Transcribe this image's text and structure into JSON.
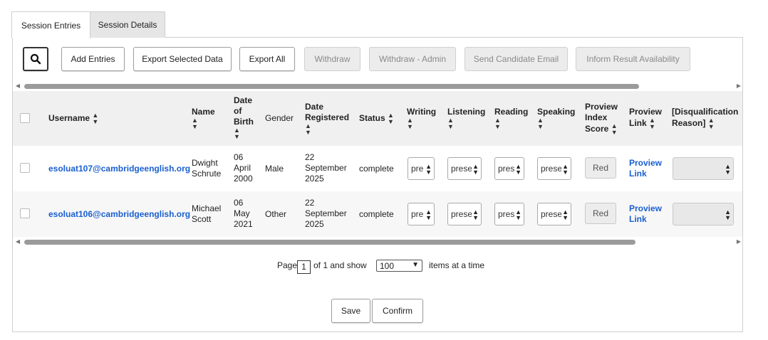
{
  "tabs": {
    "session_entries": "Session Entries",
    "session_details": "Session Details"
  },
  "toolbar": {
    "add_entries": "Add Entries",
    "export_selected": "Export Selected Data",
    "export_all": "Export All",
    "withdraw": "Withdraw",
    "withdraw_admin": "Withdraw - Admin",
    "send_email": "Send Candidate Email",
    "inform_result": "Inform Result Availability"
  },
  "columns": {
    "username": "Username",
    "name": "Name",
    "dob": [
      "Date",
      "of",
      "Birth"
    ],
    "gender": "Gender",
    "date_registered": [
      "Date",
      "Registered"
    ],
    "status": "Status",
    "writing": "Writing",
    "listening": "Listening",
    "reading": "Reading",
    "speaking": "Speaking",
    "proview_score": [
      "Proview",
      "Index",
      "Score"
    ],
    "proview_link": [
      "Proview",
      "Link"
    ],
    "disqualification": [
      "[Disqualification",
      "Reason]"
    ]
  },
  "rows": [
    {
      "username": "esoluat107@cambridgeenglish.org",
      "name": [
        "Dwight",
        "Schrute"
      ],
      "dob": [
        "06",
        "April",
        "2000"
      ],
      "gender": "Male",
      "date_registered": [
        "22",
        "September",
        "2025"
      ],
      "status": "complete",
      "writing": "pre",
      "listening": "prese",
      "reading": "pres",
      "speaking": "prese",
      "score": "Red",
      "proview_link": [
        "Proview",
        "Link"
      ]
    },
    {
      "username": "esoluat106@cambridgeenglish.org",
      "name": [
        "Michael",
        "Scott"
      ],
      "dob": [
        "06",
        "May",
        "2021"
      ],
      "gender": "Other",
      "date_registered": [
        "22",
        "September",
        "2025"
      ],
      "status": "complete",
      "writing": "pre",
      "listening": "prese",
      "reading": "pres",
      "speaking": "prese",
      "score": "Red",
      "proview_link": [
        "Proview",
        "Link"
      ]
    }
  ],
  "pagination": {
    "page_label": "Page",
    "current_page": "1",
    "of_label": "of 1 and show",
    "per_page": "100",
    "items_label": "items at a time"
  },
  "footer": {
    "save": "Save",
    "confirm": "Confirm"
  },
  "colors": {
    "link": "#1a5fd0",
    "header_bg": "#f0f0f0",
    "disabled_bg": "#ececec"
  },
  "icons": {
    "search": "search-icon",
    "sort": "sort-icon",
    "chevron": "chevron-updown-icon"
  }
}
